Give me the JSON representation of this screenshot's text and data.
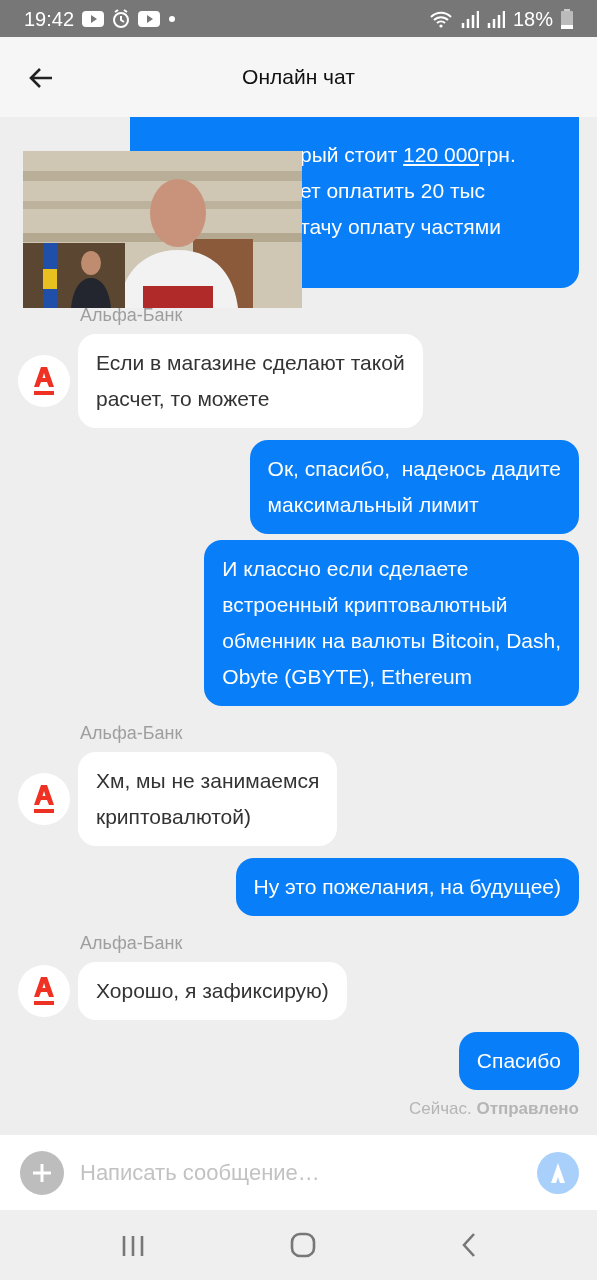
{
  "status_bar": {
    "time": "19:42",
    "battery": "18%"
  },
  "header": {
    "title": "Онлайн чат"
  },
  "messages": [
    {
      "kind": "partial",
      "lines": [
        {
          "text": "рый стоит ",
          "link": "120 000",
          "suffix": "грн."
        },
        {
          "text": "ет оплатить 20 тыс"
        },
        {
          "text": "тачу оплату частями"
        }
      ]
    },
    {
      "kind": "incoming",
      "sender": "Альфа-Банк",
      "text": "Если в магазине сделают такой\nрасчет, то можете"
    },
    {
      "kind": "outgoing",
      "text": "Ок, спасибо,  надеюсь дадите\nмаксимальный лимит"
    },
    {
      "kind": "outgoing",
      "text": "И классно если сделаете\nвстроенный криптовалютный\nобменник на валюты Bitcoin, Dash,\nObyte (GBYTE), Ethereum"
    },
    {
      "kind": "incoming",
      "sender": "Альфа-Банк",
      "text": "Хм, мы не занимаемся\nкриптовалютой)"
    },
    {
      "kind": "outgoing",
      "text": "Ну это пожелания, на будущее)"
    },
    {
      "kind": "incoming",
      "sender": "Альфа-Банк",
      "text": "Хорошо, я зафиксирую)"
    },
    {
      "kind": "outgoing",
      "text": "Спасибо"
    }
  ],
  "delivery": {
    "time": "Сейчас.",
    "status": "Отправлено"
  },
  "composer": {
    "placeholder": "Написать сообщение…"
  }
}
